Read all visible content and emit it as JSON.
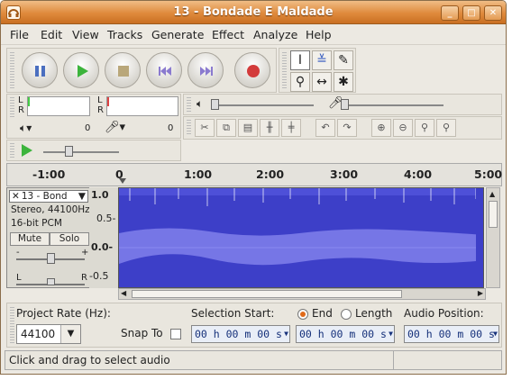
{
  "window": {
    "title": "13 - Bondade E Maldade"
  },
  "menu": [
    "File",
    "Edit",
    "View",
    "Tracks",
    "Generate",
    "Effect",
    "Analyze",
    "Help"
  ],
  "meter": {
    "left_label": "L",
    "right_label": "R",
    "scale_left": "0",
    "scale_right": "0"
  },
  "ruler": {
    "ticks": [
      "-1:00",
      "0",
      "1:00",
      "2:00",
      "3:00",
      "4:00",
      "5:00"
    ]
  },
  "track": {
    "name": "13 - Bond",
    "info1": "Stereo, 44100Hz",
    "info2": "16-bit PCM",
    "mute": "Mute",
    "solo": "Solo",
    "gain_minus": "-",
    "gain_plus": "+",
    "pan_left": "L",
    "pan_right": "R"
  },
  "vaxis": [
    "1.0",
    "0.5-",
    "0.0-",
    "-0.5"
  ],
  "selection": {
    "project_rate_label": "Project Rate (Hz):",
    "project_rate": "44100",
    "snap_to": "Snap To",
    "selection_start_label": "Selection Start:",
    "end_label": "End",
    "length_label": "Length",
    "audio_position_label": "Audio Position:",
    "start_time": "00 h 00 m 00 s",
    "end_time": "00 h 00 m 00 s",
    "audio_time": "00 h 00 m 00 s"
  },
  "status": {
    "text": "Click and drag to select audio"
  },
  "colors": {
    "titlebar": "#df8a3c",
    "waveform": "#3d3fc8",
    "waveform_rms": "#7676e6",
    "accent": "#e06a1a"
  }
}
